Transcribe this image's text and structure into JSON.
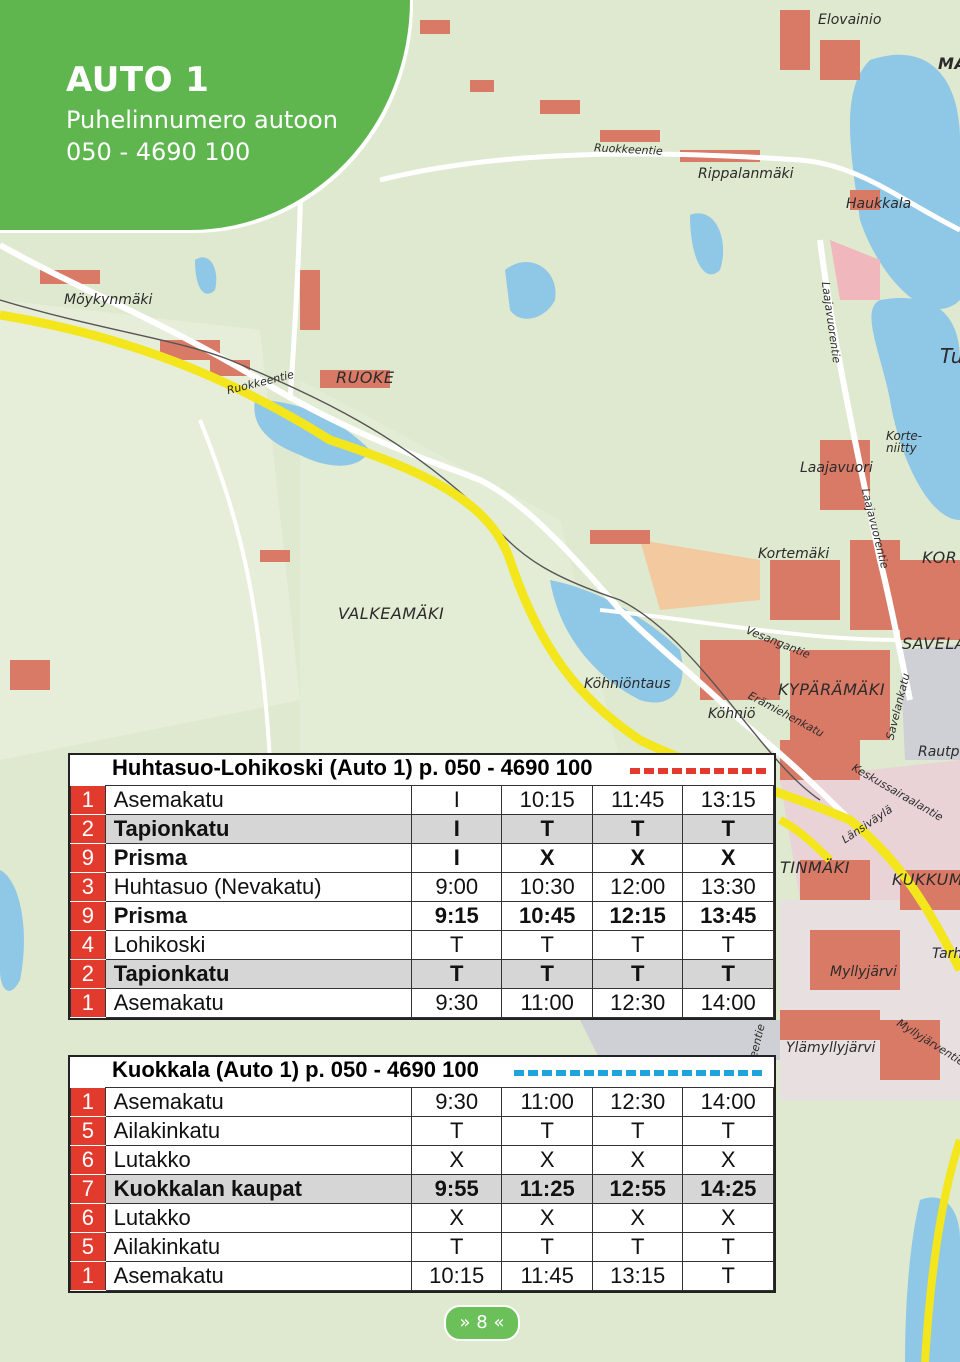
{
  "header": {
    "title": "AUTO 1",
    "subtitle": "Puhelinnumero autoon",
    "phone": "050 - 4690 100"
  },
  "map_labels": {
    "elovainio": "Elovainio",
    "ma": "MA",
    "ruokkeentie_top": "Ruokkeentie",
    "rippalanmaki": "Rippalanmäki",
    "haukkala": "Haukkala",
    "moykynmaki": "Möykynmäki",
    "ruokkeentie_left": "Ruokkeentie",
    "ruoke": "RUOKE",
    "laajavuorentie1": "Laajavuorentie",
    "tu": "Tu",
    "kortenitty": "Korte-\nniitty",
    "laajavuori": "Laajavuori",
    "laajavuorentie2": "Laajavuorentie",
    "kortemaki": "Kortemäki",
    "kor": "KOR",
    "valkeamaki": "VALKEAMÄKI",
    "vesangantie": "Vesangantie",
    "savela": "SAVELA",
    "kohniontaus": "Köhniöntaus",
    "kyparamaki": "KYPÄRÄMÄKI",
    "eramiehenkatu": "Erämiehenkatu",
    "kohnio": "Köhniö",
    "savelankatu": "Savelankatu",
    "rautpe": "Rautpe",
    "keskussairaalantie": "Keskussairaalantie",
    "lansivayla": "Länsiväylä",
    "tinmaki": "TINMÄKI",
    "kukkum": "KUKKUM",
    "myllyjarvi": "Myllyjärvi",
    "tarh": "Tarh",
    "ylamyllyjarvi": "Ylämyllyjärvi",
    "myllyjarventie": "Myllyjärventie",
    "leentie": "leentie"
  },
  "table1": {
    "title": "Huhtasuo-Lohikoski (Auto 1) p. 050 - 4690 100",
    "dash_color": "#e23b2e",
    "rows": [
      {
        "num": "1",
        "stop": "Asemakatu",
        "t": [
          "I",
          "10:15",
          "11:45",
          "13:15"
        ],
        "style": ""
      },
      {
        "num": "2",
        "stop": "Tapionkatu",
        "t": [
          "I",
          "T",
          "T",
          "T"
        ],
        "style": "hl"
      },
      {
        "num": "9",
        "stop": "Prisma",
        "t": [
          "I",
          "X",
          "X",
          "X"
        ],
        "style": "bold"
      },
      {
        "num": "3",
        "stop": "Huhtasuo (Nevakatu)",
        "t": [
          "9:00",
          "10:30",
          "12:00",
          "13:30"
        ],
        "style": ""
      },
      {
        "num": "9",
        "stop": "Prisma",
        "t": [
          "9:15",
          "10:45",
          "12:15",
          "13:45"
        ],
        "style": "bold"
      },
      {
        "num": "4",
        "stop": "Lohikoski",
        "t": [
          "T",
          "T",
          "T",
          "T"
        ],
        "style": ""
      },
      {
        "num": "2",
        "stop": "Tapionkatu",
        "t": [
          "T",
          "T",
          "T",
          "T"
        ],
        "style": "hl"
      },
      {
        "num": "1",
        "stop": "Asemakatu",
        "t": [
          "9:30",
          "11:00",
          "12:30",
          "14:00"
        ],
        "style": ""
      }
    ]
  },
  "table2": {
    "title": "Kuokkala (Auto 1) p. 050 - 4690 100",
    "dash_color": "#1fa3dc",
    "rows": [
      {
        "num": "1",
        "stop": "Asemakatu",
        "t": [
          "9:30",
          "11:00",
          "12:30",
          "14:00"
        ],
        "style": ""
      },
      {
        "num": "5",
        "stop": "Ailakinkatu",
        "t": [
          "T",
          "T",
          "T",
          "T"
        ],
        "style": ""
      },
      {
        "num": "6",
        "stop": "Lutakko",
        "t": [
          "X",
          "X",
          "X",
          "X"
        ],
        "style": ""
      },
      {
        "num": "7",
        "stop": "Kuokkalan kaupat",
        "t": [
          "9:55",
          "11:25",
          "12:55",
          "14:25"
        ],
        "style": "hl"
      },
      {
        "num": "6",
        "stop": "Lutakko",
        "t": [
          "X",
          "X",
          "X",
          "X"
        ],
        "style": ""
      },
      {
        "num": "5",
        "stop": "Ailakinkatu",
        "t": [
          "T",
          "T",
          "T",
          "T"
        ],
        "style": ""
      },
      {
        "num": "1",
        "stop": "Asemakatu",
        "t": [
          "10:15",
          "11:45",
          "13:15",
          "T"
        ],
        "style": ""
      }
    ]
  },
  "page": {
    "label": "» 8 «"
  },
  "colors": {
    "green": "#5fb64f",
    "red": "#e23b2e",
    "blue": "#1fa3dc",
    "road": "#f3e61c"
  }
}
